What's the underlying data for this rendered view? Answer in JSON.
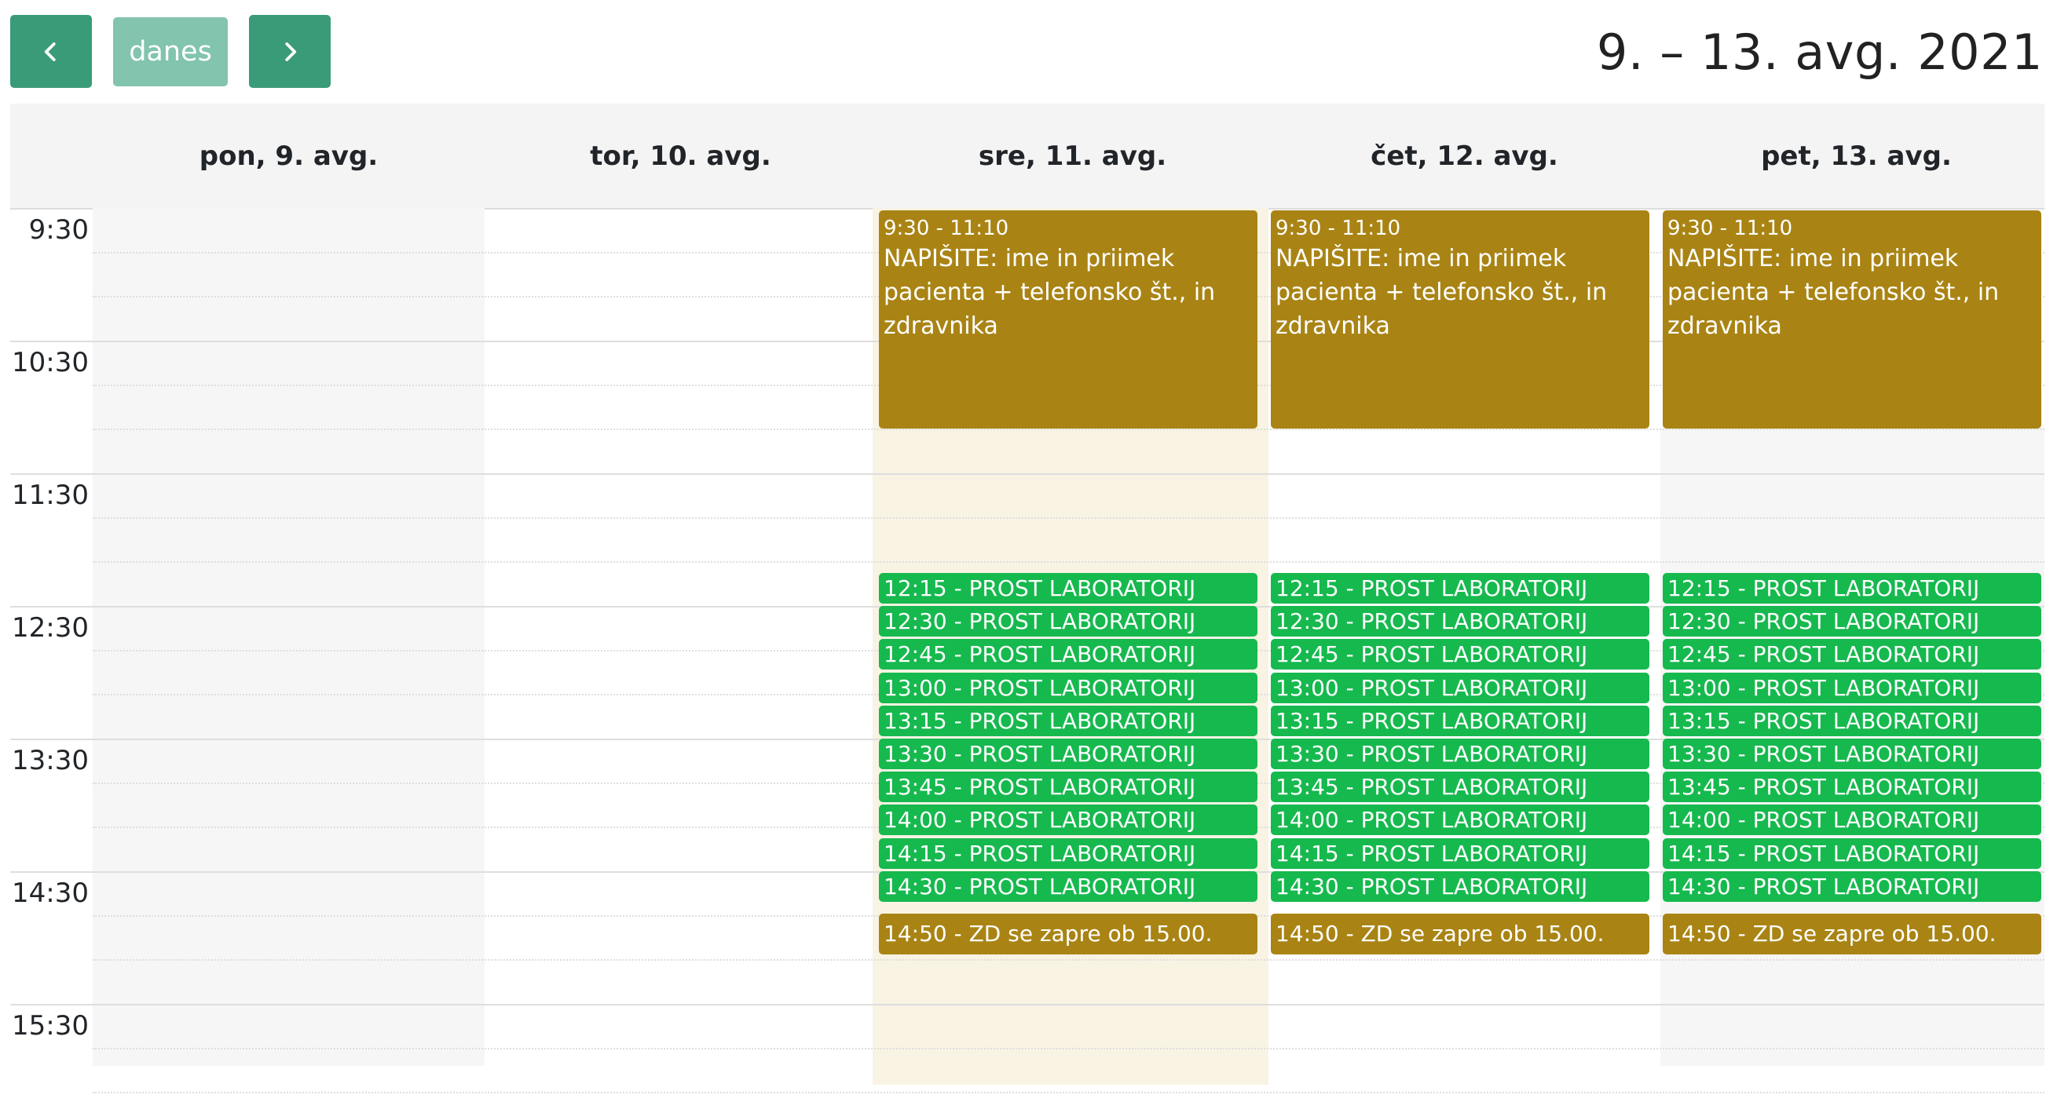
{
  "toolbar": {
    "today_label": "danes",
    "range_title": "9. – 13. avg. 2021",
    "prev_icon": "chevron-left-icon",
    "next_icon": "chevron-right-icon"
  },
  "colors": {
    "nav_button": "#3a9b78",
    "today_button": "#82c4ad",
    "meeting_event": "#a98414",
    "lab_event": "#16b94e",
    "today_highlight": "#f8f3e3",
    "unavailable": "#f6f6f6"
  },
  "days": [
    {
      "label": "pon, 9. avg."
    },
    {
      "label": "tor, 10. avg."
    },
    {
      "label": "sre, 11. avg."
    },
    {
      "label": "čet, 12. avg."
    },
    {
      "label": "pet, 13. avg."
    }
  ],
  "time_labels": [
    "9:30",
    "10:30",
    "11:30",
    "12:30",
    "13:30",
    "14:30",
    "15:30"
  ],
  "events": {
    "meeting": {
      "time": "9:30 - 11:10",
      "title": "NAPIŠITE: ime in priimek pacienta + telefonsko št., in zdravnika"
    },
    "labs": [
      "12:15 - PROST LABORATORIJ",
      "12:30 - PROST LABORATORIJ",
      "12:45 - PROST LABORATORIJ",
      "13:00 - PROST LABORATORIJ",
      "13:15 - PROST LABORATORIJ",
      "13:30 - PROST LABORATORIJ",
      "13:45 - PROST LABORATORIJ",
      "14:00 - PROST LABORATORIJ",
      "14:15 - PROST LABORATORIJ",
      "14:30 - PROST LABORATORIJ"
    ],
    "closing": "14:50 - ZD se zapre ob 15.00."
  }
}
